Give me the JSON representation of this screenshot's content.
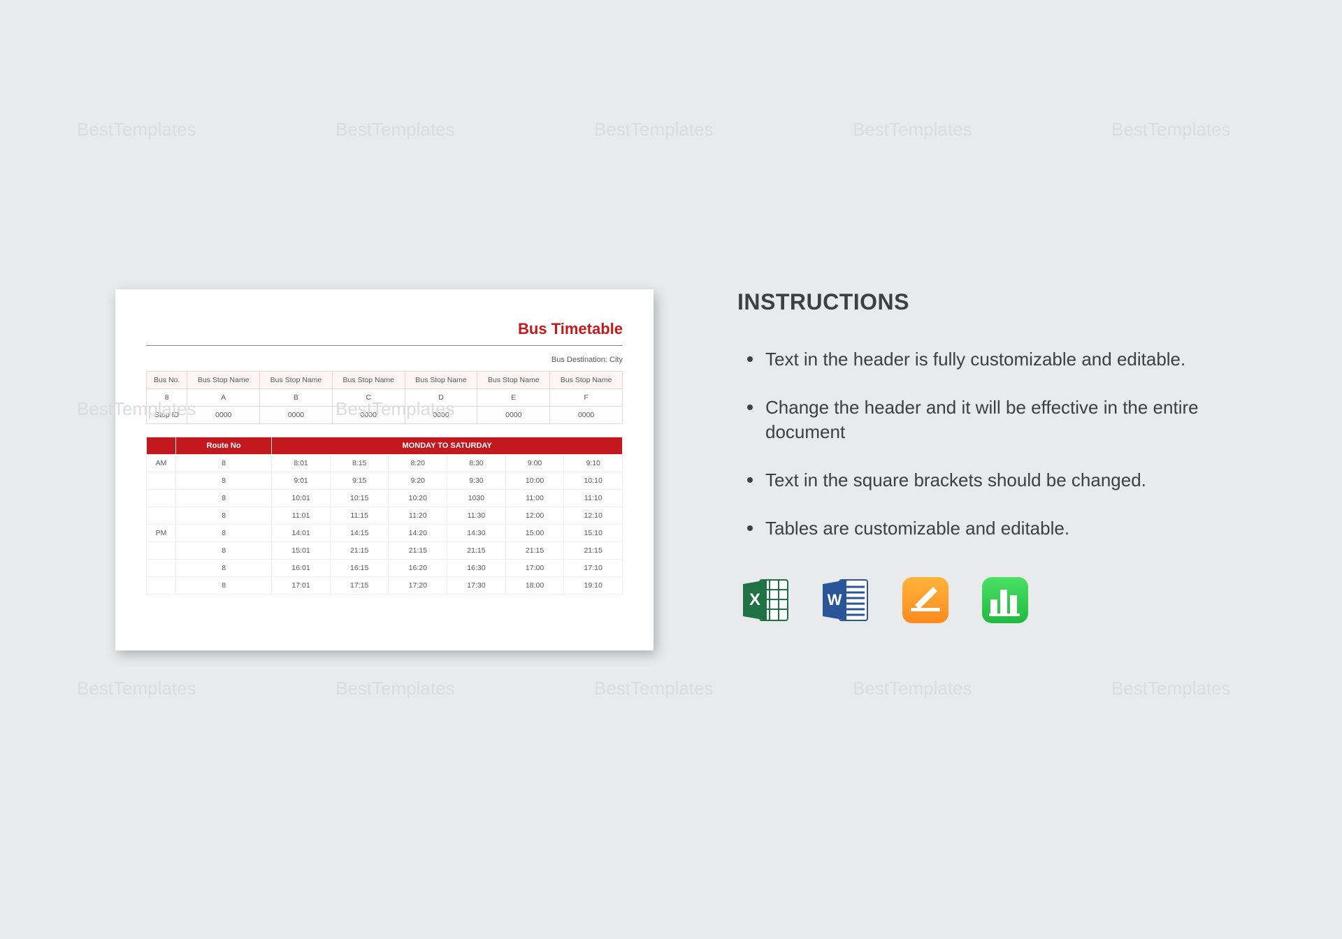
{
  "watermark": "BestTemplates",
  "preview": {
    "title": "Bus Timetable",
    "destination": "Bus Destination: City",
    "info": {
      "headers": [
        "Bus No.",
        "Bus Stop Name",
        "Bus Stop Name",
        "Bus Stop Name",
        "Bus Stop Name",
        "Bus Stop Name",
        "Bus Stop Name"
      ],
      "rows": [
        [
          "8",
          "A",
          "B",
          "C",
          "D",
          "E",
          "F"
        ],
        [
          "Stop ID",
          "0000",
          "0000",
          "0000",
          "0000",
          "0000",
          "0000"
        ]
      ]
    },
    "schedule": {
      "header_left": "Route No",
      "header_right": "MONDAY TO SATURDAY",
      "rows": [
        [
          "AM",
          "8",
          "8:01",
          "8:15",
          "8:20",
          "8:30",
          "9:00",
          "9:10"
        ],
        [
          "",
          "8",
          "9:01",
          "9:15",
          "9:20",
          "9:30",
          "10:00",
          "10:10"
        ],
        [
          "",
          "8",
          "10:01",
          "10:15",
          "10:20",
          "1030",
          "11:00",
          "11:10"
        ],
        [
          "",
          "8",
          "11:01",
          "11:15",
          "11:20",
          "11:30",
          "12:00",
          "12:10"
        ],
        [
          "PM",
          "8",
          "14:01",
          "14:15",
          "14:20",
          "14:30",
          "15:00",
          "15:10"
        ],
        [
          "",
          "8",
          "15:01",
          "21:15",
          "21:15",
          "21:15",
          "21:15",
          "21:15"
        ],
        [
          "",
          "8",
          "16:01",
          "16:15",
          "16:20",
          "16:30",
          "17:00",
          "17:10"
        ],
        [
          "",
          "8",
          "17:01",
          "17:15",
          "17:20",
          "17:30",
          "18:00",
          "19:10"
        ]
      ]
    }
  },
  "instructions": {
    "heading": "INSTRUCTIONS",
    "items": [
      "Text in the header is fully customizable and editable.",
      "Change the header and it will be effective in the entire document",
      "Text in the square brackets should be changed.",
      "Tables are customizable and editable."
    ]
  },
  "apps": [
    "excel",
    "word",
    "pages",
    "numbers"
  ]
}
